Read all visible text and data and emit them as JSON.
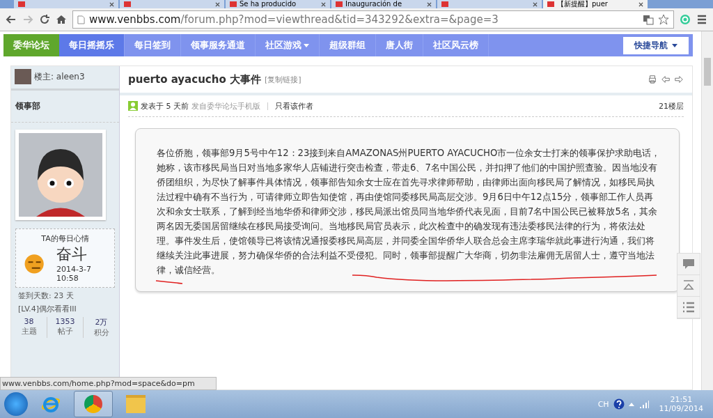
{
  "browser": {
    "tabs": [
      {
        "selected": false
      },
      {
        "selected": false
      },
      {
        "title": "Se ha producido",
        "selected": false
      },
      {
        "title": "Inauguración de",
        "selected": false
      },
      {
        "selected": false
      },
      {
        "title": "【新提醒】puer",
        "selected": true
      }
    ],
    "url_host": "www.venbbs.com",
    "url_path": "/forum.php?mod=viewthread&tid=343292&extra=&page=3",
    "status_url": "www.venbbs.com/home.php?mod=space&do=pm"
  },
  "nav": {
    "brand": "委华论坛",
    "items": [
      {
        "label": "每日摇摇乐",
        "selected": true,
        "dropdown": false
      },
      {
        "label": "每日签到",
        "selected": false,
        "dropdown": false
      },
      {
        "label": "领事服务通道",
        "selected": false,
        "dropdown": false
      },
      {
        "label": "社区游戏",
        "selected": false,
        "dropdown": true
      },
      {
        "label": "超级群组",
        "selected": false,
        "dropdown": false
      },
      {
        "label": "唐人街",
        "selected": false,
        "dropdown": false
      },
      {
        "label": "社区风云榜",
        "selected": false,
        "dropdown": false
      }
    ],
    "quick_nav": "快捷导航"
  },
  "sidebar": {
    "author": "楼主: aleen3",
    "group": "领事部",
    "mood": {
      "title": "TA的每日心情",
      "mood": "奋斗",
      "date": "2014-3-7",
      "time": "10:58"
    },
    "signin": "签到天数: 23 天",
    "level": "[LV.4]偶尔看看III",
    "stats": [
      {
        "value": "38",
        "label": "主题"
      },
      {
        "value": "1353",
        "label": "帖子"
      },
      {
        "value": "2万",
        "label": "积分"
      }
    ]
  },
  "post": {
    "title": "puerto ayacucho 大事件",
    "copy_link": "[复制链接]",
    "posted": "发表于 5 天前",
    "source": "发自委华论坛手机版",
    "only_author": "只看该作者",
    "floor": "21楼层",
    "body": "各位侨胞，领事部9月5号中午12：23接到来自AMAZONAS州PUERTO AYACUCHO市一位余女士打来的领事保护求助电话，她称，该市移民局当日对当地多家华人店铺进行突击检查，带走6、7名中国公民，并扣押了他们的中国护照查验。因当地没有侨团组织，为尽快了解事件具体情况，领事部告知余女士应在首先寻求律师帮助，由律师出面向移民局了解情况，如移民局执法过程中确有不当行为，可请律师立即告知使馆，再由使馆同委移民局高层交涉。9月6日中午12点15分，领事部工作人员再次和余女士联系，了解到经当地华侨和律师交涉，移民局派出馆员同当地华侨代表见面，目前7名中国公民已被释放5名，其余两名因无委国居留继续在移民局接受询问。当地移民局官员表示，此次检查中的确发现有违法委移民法律的行为，将依法处理。事件发生后，使馆领导已将该情况通报委移民局高层，并同委全国华侨华人联合总会主席李瑞华就此事进行沟通，我们将继续关注此事进展，努力确保华侨的合法利益不受侵犯。同时，领事部提醒广大华商，切勿非法雇佣无居留人士，遵守当地法律，诚信经营。"
  },
  "taskbar": {
    "lang": "CH",
    "time": "21:51",
    "date": "11/09/2014"
  }
}
